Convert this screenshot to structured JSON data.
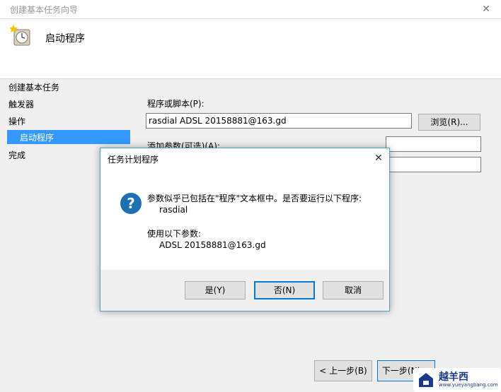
{
  "window": {
    "title": "创建基本任务向导",
    "close_glyph": "✕"
  },
  "header": {
    "title": "启动程序",
    "icon": "clock-icon"
  },
  "steps": [
    {
      "label": "创建基本任务"
    },
    {
      "label": "触发器"
    },
    {
      "label": "操作"
    },
    {
      "label": "启动程序",
      "active": true
    },
    {
      "label": "完成"
    }
  ],
  "form": {
    "program_label": "程序或脚本(P):",
    "program_value": "rasdial ADSL 20158881@163.gd",
    "browse_label": "浏览(R)...",
    "args_label": "添加参数(可选)(A):",
    "args_value": "",
    "start_value": ""
  },
  "nav": {
    "back_label": "< 上一步(B)",
    "next_label": "下一步(N) >"
  },
  "dialog": {
    "title": "任务计划程序",
    "close_glyph": "✕",
    "icon": "question-icon",
    "message_line1": "参数似乎已包括在\"程序\"文本框中。是否要运行以下程序:",
    "message_line2": "rasdial",
    "message_line3": "使用以下参数:",
    "message_line4": "ADSL 20158881@163.gd",
    "yes_label": "是(Y)",
    "no_label": "否(N)",
    "cancel_label": "取消"
  },
  "watermark": {
    "text": "越羊西",
    "url": "www.yueyangbang.com"
  },
  "colors": {
    "accent": "#3399ff",
    "focus": "#0078d7",
    "icon_blue": "#1f6fb5"
  }
}
